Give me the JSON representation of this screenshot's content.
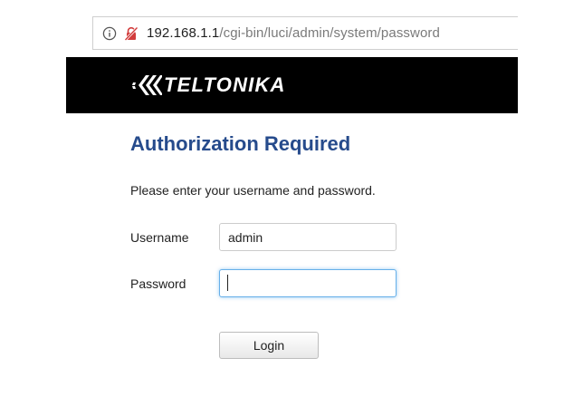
{
  "browser": {
    "url_host": "192.168.1.1",
    "url_path": "/cgi-bin/luci/admin/system/password",
    "info_icon": "info-circle-icon",
    "insecure_icon": "not-secure-lock-icon",
    "insecure_color": "#cc2222"
  },
  "header": {
    "logo_text": "TELTONIKA",
    "background": "#000000"
  },
  "login": {
    "title": "Authorization Required",
    "description": "Please enter your username and password.",
    "username_label": "Username",
    "username_value": "admin",
    "password_label": "Password",
    "password_value": "",
    "login_label": "Login",
    "title_color": "#264b8c",
    "focus_color": "#66afe9"
  }
}
